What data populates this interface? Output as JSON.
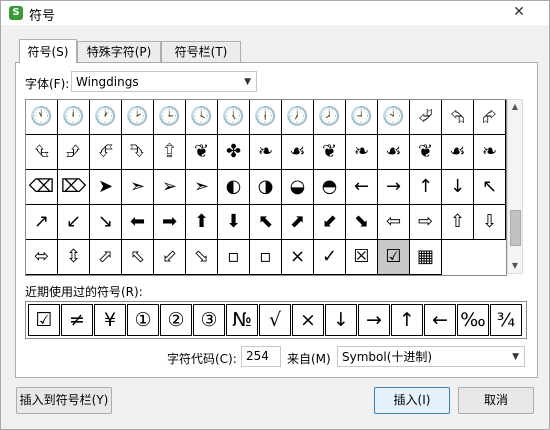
{
  "window": {
    "title": "符号",
    "close_glyph": "✕",
    "app_icon": "S"
  },
  "tabs": [
    {
      "label": "符号(S)",
      "active": true
    },
    {
      "label": "特殊字符(P)",
      "active": false
    },
    {
      "label": "符号栏(T)",
      "active": false
    }
  ],
  "font": {
    "label": "字体(F):",
    "value": "Wingdings",
    "arrow": "▼"
  },
  "symbols": [
    [
      "🕚",
      "🕛",
      "🕐",
      "🕑",
      "🕒",
      "🕓",
      "🕔",
      "🕕",
      "🕖",
      "🕗",
      "🕘",
      "🕙",
      "⮰",
      "⮲",
      "⮳"
    ],
    [
      "⮴",
      "⮵",
      "⮶",
      "⮷",
      "⮸",
      "❦",
      "✤",
      "❧",
      "☙",
      "❦",
      "❧",
      "☙",
      "❦",
      "☙",
      "❧"
    ],
    [
      "⌫",
      "⌦",
      "➤",
      "➣",
      "➢",
      "➣",
      "◐",
      "◑",
      "◒",
      "◓",
      "←",
      "→",
      "↑",
      "↓",
      "↖"
    ],
    [
      "↗",
      "↙",
      "↘",
      "⬅",
      "➡",
      "⬆",
      "⬇",
      "⬉",
      "⬈",
      "⬋",
      "⬊",
      "⇦",
      "⇨",
      "⇧",
      "⇩"
    ],
    [
      "⬄",
      "⇳",
      "⬀",
      "⬁",
      "⬃",
      "⬂",
      "▫",
      "▫",
      "×",
      "✓",
      "☒",
      "☑",
      "▦",
      "",
      ""
    ]
  ],
  "selected": {
    "row": 4,
    "col": 11
  },
  "recent_label": "近期使用过的符号(R):",
  "recent": [
    "☑",
    "≠",
    "¥",
    "①",
    "②",
    "③",
    "№",
    "√",
    "×",
    "↓",
    "→",
    "↑",
    "←",
    "‰",
    "¾"
  ],
  "char_code": {
    "label": "字符代码(C):",
    "value": "254"
  },
  "from": {
    "label": "来自(M)",
    "value": "Symbol(十进制)",
    "arrow": "▼"
  },
  "buttons": {
    "insert_to_bar": "插入到符号栏(Y)",
    "insert": "插入(I)",
    "cancel": "取消"
  },
  "scroll": {
    "up": "▲",
    "down": "▼"
  }
}
